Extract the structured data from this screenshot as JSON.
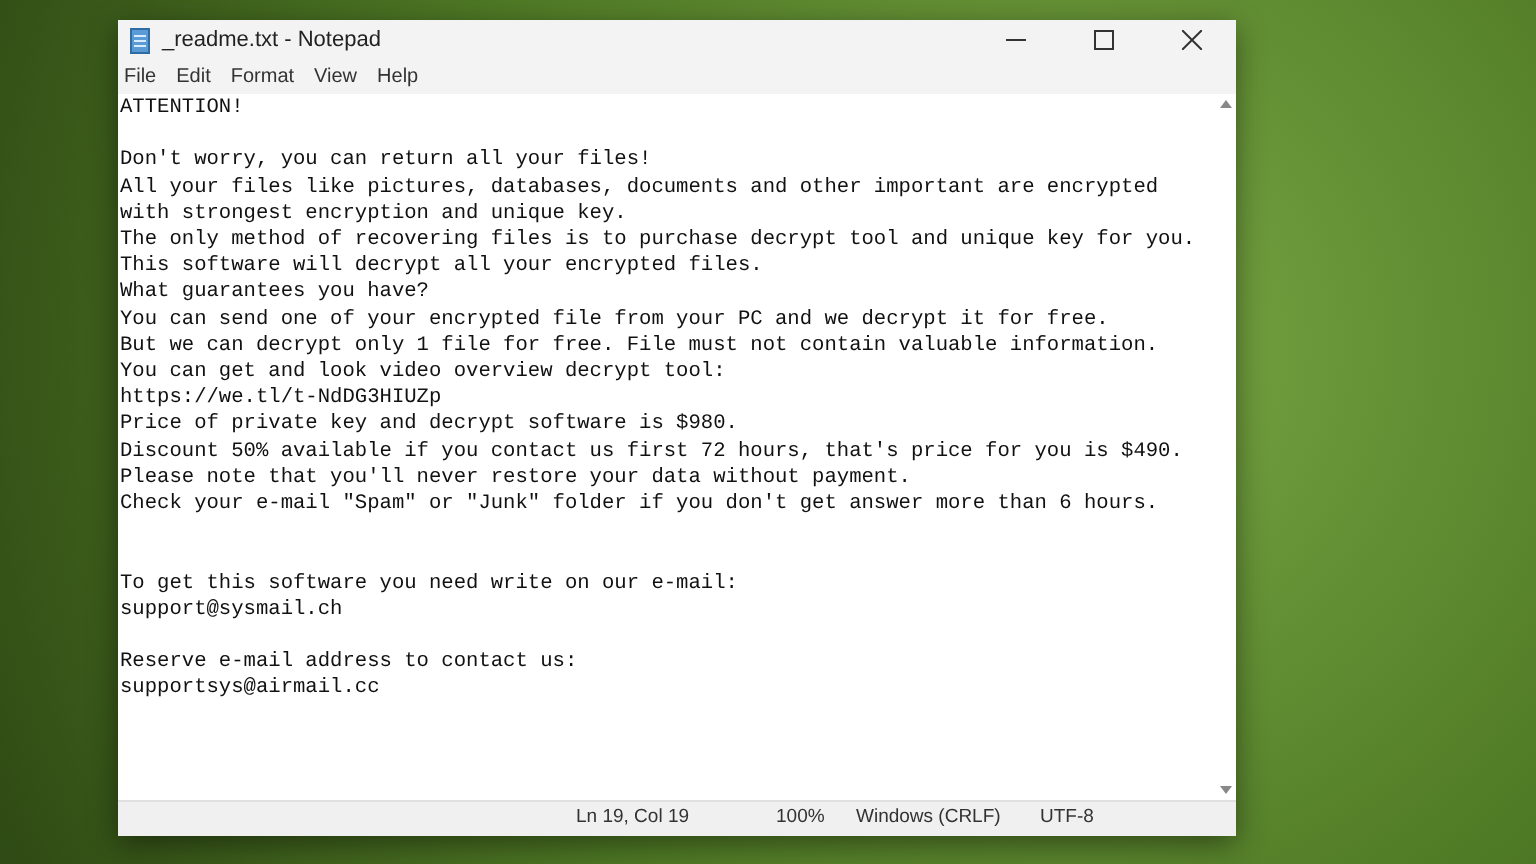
{
  "window": {
    "title": "_readme.txt - Notepad"
  },
  "menu": [
    "File",
    "Edit",
    "Format",
    "View",
    "Help"
  ],
  "document": {
    "paragraphs": [
      {
        "lines": [
          "ATTENTION!"
        ]
      },
      {
        "lines": [
          "Don't worry, you can return all your files!",
          "All your files like pictures, databases, documents and other important are encrypted",
          "with strongest encryption and unique key.",
          "The only method of recovering files is to purchase decrypt tool and unique key for you.",
          "This software will decrypt all your encrypted files.",
          "What guarantees you have?",
          "You can send one of your encrypted file from your PC and we decrypt it for free.",
          "But we can decrypt only 1 file for free. File must not contain valuable information.",
          "You can get and look video overview decrypt tool:",
          "https://we.tl/t-NdDG3HIUZp",
          "Price of private key and decrypt software is $980.",
          "Discount 50% available if you contact us first 72 hours, that's price for you is $490.",
          "Please note that you'll never restore your data without payment.",
          "Check your e-mail \"Spam\" or \"Junk\" folder if you don't get answer more than 6 hours."
        ]
      },
      {
        "lines": [
          "To get this software you need write on our e-mail:",
          "support@sysmail.ch"
        ]
      },
      {
        "lines": [
          "Reserve e-mail address to contact us:",
          "supportsys@airmail.cc"
        ]
      }
    ]
  },
  "status_bar": {
    "position": "Ln 19, Col 19",
    "zoom": "100%",
    "line_ending": "Windows (CRLF)",
    "encoding": "UTF-8"
  }
}
